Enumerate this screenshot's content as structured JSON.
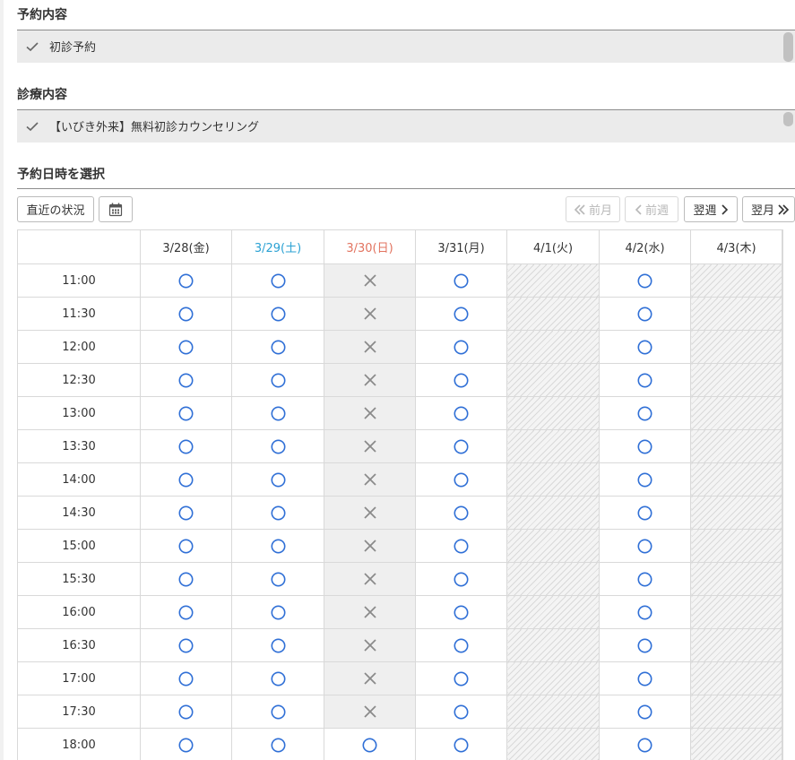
{
  "reservation": {
    "title": "予約内容",
    "selected": "初診予約"
  },
  "treatment": {
    "title": "診療内容",
    "selected": "【いびき外来】無料初診カウンセリング"
  },
  "datetime": {
    "title": "予約日時を選択"
  },
  "toolbar": {
    "recent_label": "直近の状況",
    "prev_month_label": "前月",
    "prev_week_label": "前週",
    "next_week_label": "翌週",
    "next_month_label": "翌月"
  },
  "colors": {
    "available": "#2f6fd6",
    "unavailable": "#8a8a8a",
    "saturday": "#2aa1d3",
    "sunday": "#e2735f"
  },
  "schedule": {
    "days": [
      {
        "label": "3/28(金)",
        "kind": "weekday"
      },
      {
        "label": "3/29(土)",
        "kind": "saturday"
      },
      {
        "label": "3/30(日)",
        "kind": "sunday"
      },
      {
        "label": "3/31(月)",
        "kind": "weekday"
      },
      {
        "label": "4/1(火)",
        "kind": "closed"
      },
      {
        "label": "4/2(水)",
        "kind": "weekday"
      },
      {
        "label": "4/3(木)",
        "kind": "closed"
      }
    ],
    "rows": [
      {
        "time": "11:00",
        "slots": [
          "○",
          "○",
          "×",
          "○",
          "",
          "○",
          ""
        ]
      },
      {
        "time": "11:30",
        "slots": [
          "○",
          "○",
          "×",
          "○",
          "",
          "○",
          ""
        ]
      },
      {
        "time": "12:00",
        "slots": [
          "○",
          "○",
          "×",
          "○",
          "",
          "○",
          ""
        ]
      },
      {
        "time": "12:30",
        "slots": [
          "○",
          "○",
          "×",
          "○",
          "",
          "○",
          ""
        ]
      },
      {
        "time": "13:00",
        "slots": [
          "○",
          "○",
          "×",
          "○",
          "",
          "○",
          ""
        ]
      },
      {
        "time": "13:30",
        "slots": [
          "○",
          "○",
          "×",
          "○",
          "",
          "○",
          ""
        ]
      },
      {
        "time": "14:00",
        "slots": [
          "○",
          "○",
          "×",
          "○",
          "",
          "○",
          ""
        ]
      },
      {
        "time": "14:30",
        "slots": [
          "○",
          "○",
          "×",
          "○",
          "",
          "○",
          ""
        ]
      },
      {
        "time": "15:00",
        "slots": [
          "○",
          "○",
          "×",
          "○",
          "",
          "○",
          ""
        ]
      },
      {
        "time": "15:30",
        "slots": [
          "○",
          "○",
          "×",
          "○",
          "",
          "○",
          ""
        ]
      },
      {
        "time": "16:00",
        "slots": [
          "○",
          "○",
          "×",
          "○",
          "",
          "○",
          ""
        ]
      },
      {
        "time": "16:30",
        "slots": [
          "○",
          "○",
          "×",
          "○",
          "",
          "○",
          ""
        ]
      },
      {
        "time": "17:00",
        "slots": [
          "○",
          "○",
          "×",
          "○",
          "",
          "○",
          ""
        ]
      },
      {
        "time": "17:30",
        "slots": [
          "○",
          "○",
          "×",
          "○",
          "",
          "○",
          ""
        ]
      },
      {
        "time": "18:00",
        "slots": [
          "○",
          "○",
          "○",
          "○",
          "",
          "○",
          ""
        ]
      }
    ]
  }
}
